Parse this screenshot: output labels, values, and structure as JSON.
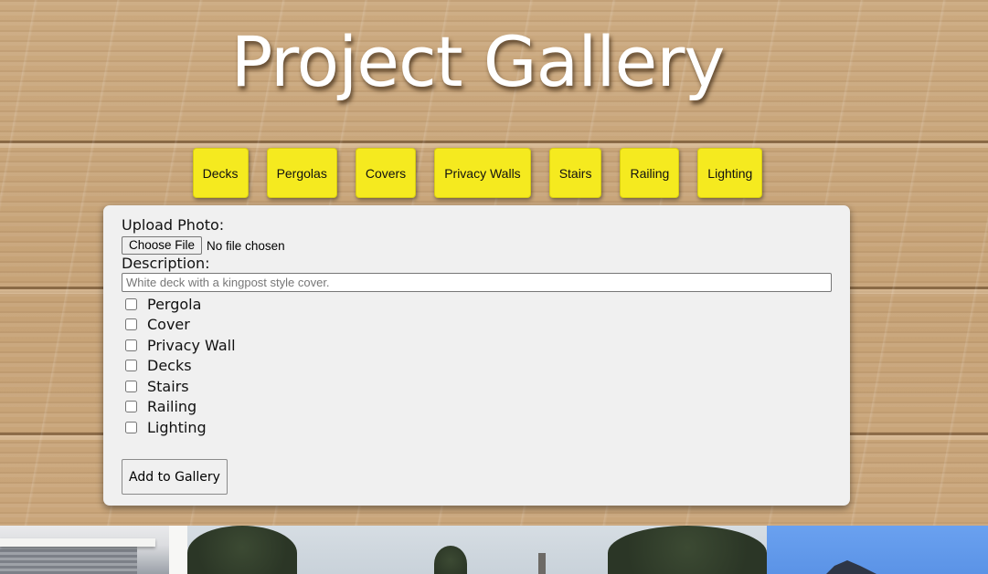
{
  "page": {
    "title": "Project Gallery"
  },
  "filters": [
    {
      "label": "Decks"
    },
    {
      "label": "Pergolas"
    },
    {
      "label": "Covers"
    },
    {
      "label": "Privacy Walls"
    },
    {
      "label": "Stairs"
    },
    {
      "label": "Railing"
    },
    {
      "label": "Lighting"
    }
  ],
  "upload_form": {
    "photo_label": "Upload Photo:",
    "file_button_label": "Choose File",
    "file_status": "No file chosen",
    "description_label": "Description:",
    "description_value": "",
    "description_placeholder": "White deck with a kingpost style cover.",
    "categories": [
      {
        "label": "Pergola",
        "checked": false
      },
      {
        "label": "Cover",
        "checked": false
      },
      {
        "label": "Privacy Wall",
        "checked": false
      },
      {
        "label": "Decks",
        "checked": false
      },
      {
        "label": "Stairs",
        "checked": false
      },
      {
        "label": "Railing",
        "checked": false
      },
      {
        "label": "Lighting",
        "checked": false
      }
    ],
    "submit_label": "Add to Gallery"
  },
  "colors": {
    "filter_button_bg": "#f5ea1f",
    "panel_bg": "#f0f0f0",
    "title_color": "#ffffff",
    "wood_bg": "#c9a57a"
  }
}
